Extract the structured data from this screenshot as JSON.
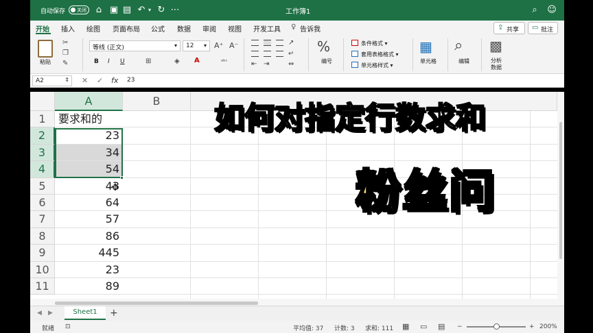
{
  "titlebar": {
    "autosave_label": "自动保存",
    "toggle_label": "关闭",
    "doc_title": "工作簿1"
  },
  "menu": {
    "items": [
      "开始",
      "插入",
      "绘图",
      "页面布局",
      "公式",
      "数据",
      "审阅",
      "视图",
      "开发工具",
      "告诉我"
    ],
    "share_label": "共享",
    "comment_label": "批注"
  },
  "ribbon": {
    "paste_label": "粘贴",
    "font_name": "等线 (正文)",
    "font_size": "12",
    "bold": "B",
    "italic": "I",
    "underline": "U",
    "number_label": "编号",
    "cond_format": "条件格式",
    "table_format": "套用表格格式",
    "cell_style": "单元格样式",
    "cells_label": "单元格",
    "edit_label": "编辑",
    "analyze_label": "分析",
    "analyze_label2": "数据"
  },
  "formula_bar": {
    "name_box": "A2",
    "fx": "fx",
    "value": "23"
  },
  "grid": {
    "columns": [
      "A",
      "B"
    ],
    "rows": [
      "1",
      "2",
      "3",
      "4",
      "5",
      "6",
      "7",
      "8",
      "9",
      "10",
      "11"
    ],
    "cells": [
      "要求和的",
      "23",
      "34",
      "54",
      "43",
      "64",
      "57",
      "86",
      "445",
      "23",
      "89"
    ]
  },
  "overlay": {
    "caption_main": "如何对指定行数求和",
    "caption_sub": "粉丝问"
  },
  "sheets": {
    "tab": "Sheet1",
    "add": "+"
  },
  "status": {
    "ready": "就绪",
    "average": "平均值: 37",
    "count": "计数: 3",
    "sum": "求和: 111",
    "zoom": "200%"
  }
}
